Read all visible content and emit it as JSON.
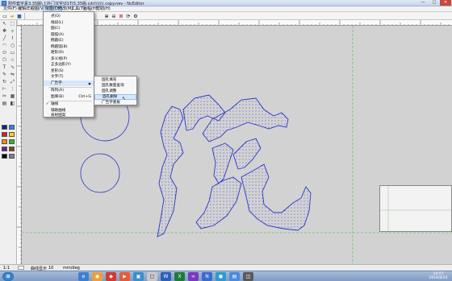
{
  "window": {
    "title": "附件套字素3.35版\\上外门汉字\\01T(5.35版.cdr)\\\\\\\\\\\\ copy.nev - NcEditor",
    "controls": [
      "—",
      "□",
      "✕"
    ]
  },
  "menubar": {
    "items": [
      "文件(F)",
      "编辑(E)",
      "视图(V)",
      "绘图(D)",
      "修改(M)",
      "工具(T)",
      "画幅(H)",
      "帮助(H)"
    ]
  },
  "dropdown": {
    "items": [
      {
        "label": "点(O)",
        "shortcut": "",
        "submenu": false
      },
      {
        "label": "线段(L)",
        "shortcut": "",
        "submenu": false
      },
      {
        "label": "圆(C)",
        "shortcut": "",
        "submenu": false
      },
      {
        "label": "圆弧(A)",
        "shortcut": "",
        "submenu": false
      },
      {
        "label": "椭圆(E)",
        "shortcut": "",
        "submenu": false
      },
      {
        "label": "椭圆弧(B)",
        "shortcut": "",
        "submenu": false
      },
      {
        "label": "矩形(R)",
        "shortcut": "",
        "submenu": false
      },
      {
        "label": "多义线(P)",
        "shortcut": "",
        "submenu": false
      },
      {
        "label": "正多边形(Y)",
        "shortcut": "",
        "submenu": false
      },
      {
        "label": "星形(S)",
        "shortcut": "",
        "submenu": false
      },
      {
        "label": "文字(T)",
        "shortcut": "",
        "submenu": false
      },
      {
        "label": "广告字",
        "shortcut": "",
        "submenu": true
      },
      {
        "label": "阵列(A)",
        "shortcut": "",
        "submenu": false
      },
      {
        "label": "图库(B)",
        "shortcut": "Ctrl+G",
        "submenu": false
      },
      {
        "label": "轴线",
        "shortcut": "",
        "submenu": false,
        "checked": true
      },
      {
        "label": "辅助曲线",
        "shortcut": "",
        "submenu": false
      },
      {
        "label": "投射图案",
        "shortcut": "",
        "submenu": false
      }
    ]
  },
  "submenu": {
    "items": [
      "固孔填充",
      "固孔数量查询",
      "固孔调整",
      "固孔删除",
      "广告字底板"
    ]
  },
  "statusbar": {
    "zoom": "1:1",
    "mode": "曲线显示",
    "value": "10",
    "unit": "mm/deg"
  },
  "taskbar": {
    "time": "10:07",
    "date": "2018/8/24"
  },
  "colors": {
    "curve": "#2a35c9",
    "menu_highlight": "#d7e7fa",
    "guide": "#4db84d"
  },
  "swatches": [
    "#1a1aa0",
    "#2d8ad8",
    "#d42222",
    "#ffd600",
    "#ff8c00",
    "#2bb53a",
    "#6a1e8c",
    "#7a4a1e",
    "#0a0a0a",
    "#808080"
  ]
}
